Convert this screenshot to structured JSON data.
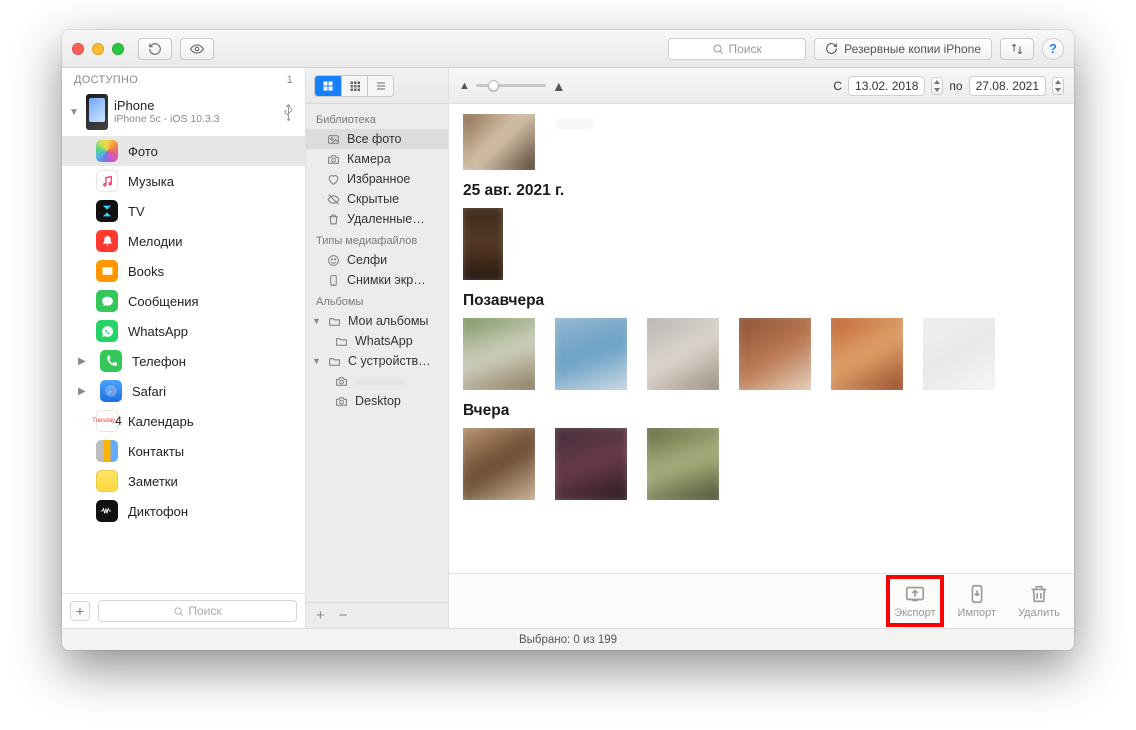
{
  "toolbar": {
    "search_placeholder": "Поиск",
    "backup_label": "Резервные копии iPhone"
  },
  "sidebar": {
    "header": "ДОСТУПНО",
    "device_count": "1",
    "device": {
      "name": "iPhone",
      "subtitle": "iPhone 5c - iOS 10.3.3"
    },
    "items": [
      {
        "label": "Фото",
        "icon": "ic-photos",
        "selected": true
      },
      {
        "label": "Музыка",
        "icon": "ic-music"
      },
      {
        "label": "TV",
        "icon": "ic-tv"
      },
      {
        "label": "Мелодии",
        "icon": "ic-ring"
      },
      {
        "label": "Books",
        "icon": "ic-books"
      },
      {
        "label": "Сообщения",
        "icon": "ic-msg"
      },
      {
        "label": "WhatsApp",
        "icon": "ic-wa"
      },
      {
        "label": "Телефон",
        "icon": "ic-phone",
        "hasChildren": true
      },
      {
        "label": "Safari",
        "icon": "ic-safari",
        "hasChildren": true
      },
      {
        "label": "Календарь",
        "icon": "ic-cal"
      },
      {
        "label": "Контакты",
        "icon": "ic-contacts"
      },
      {
        "label": "Заметки",
        "icon": "ic-notes"
      },
      {
        "label": "Диктофон",
        "icon": "ic-voice"
      }
    ],
    "footer_search_placeholder": "Поиск"
  },
  "midcol": {
    "library_header": "Библиотека",
    "library": [
      {
        "label": "Все фото",
        "icon": "photo",
        "selected": true
      },
      {
        "label": "Камера",
        "icon": "camera"
      },
      {
        "label": "Избранное",
        "icon": "heart"
      },
      {
        "label": "Скрытые",
        "icon": "hidden"
      },
      {
        "label": "Удаленные…",
        "icon": "trash"
      }
    ],
    "mediatypes_header": "Типы медиафайлов",
    "mediatypes": [
      {
        "label": "Селфи",
        "icon": "selfie"
      },
      {
        "label": "Снимки экр…",
        "icon": "device"
      }
    ],
    "albums_header": "Альбомы",
    "albums": {
      "my_albums": "Мои альбомы",
      "whatsapp": "WhatsApp",
      "from_device": "С устройств…",
      "blurred": "————",
      "desktop": "Desktop"
    }
  },
  "content": {
    "date_from_label": "С",
    "date_from": "13.02. 2018",
    "date_to_label": "по",
    "date_to": "27.08. 2021",
    "sections": [
      {
        "title": "25 авг. 2021 г."
      },
      {
        "title": "Позавчера"
      },
      {
        "title": "Вчера"
      }
    ],
    "actions": {
      "export": "Экспорт",
      "import": "Импорт",
      "delete": "Удалить"
    }
  },
  "statusbar": "Выбрано: 0 из 199"
}
